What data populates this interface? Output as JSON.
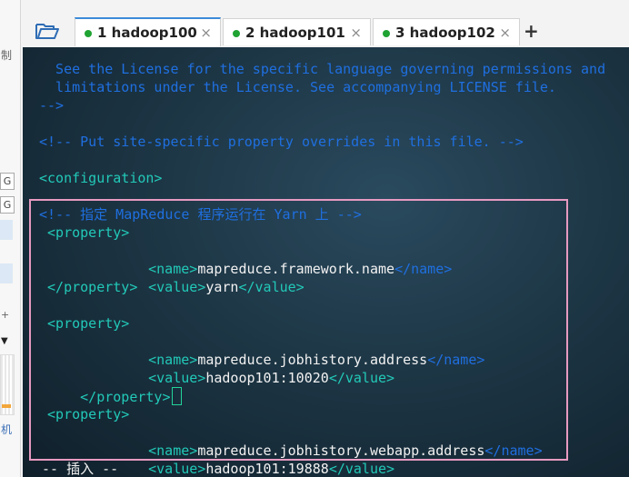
{
  "left_strip": {
    "top_char": "制",
    "box1": "G",
    "box2": "G",
    "plus": "+",
    "tri": "▼",
    "bottom_char": "机"
  },
  "tabs": [
    {
      "label": "1 hadoop100",
      "close": "×"
    },
    {
      "label": "2 hadoop101",
      "close": "×"
    },
    {
      "label": "3 hadoop102",
      "close": "×"
    }
  ],
  "new_tab": "+",
  "colors": {
    "comment": "#1f6fe0",
    "tag": "#22c9b8",
    "text": "#f2f2f2",
    "status_dot": "#1fa332",
    "highlight": "#e79ac1"
  },
  "editor": {
    "license_1": "  See the License for the specific language governing permissions and",
    "license_2": "  limitations under the License. See accompanying LICENSE file.",
    "comment_end": "-->",
    "put_site": "<!-- Put site-specific property overrides in this file. -->",
    "configuration": "<configuration>",
    "mr_comment": "<!-- 指定 MapReduce 程序运行在 Yarn 上 -->",
    "property_open": " <property>",
    "property_close": " </property>",
    "name_open": "<name>",
    "name_close": "</name>",
    "value_open": "<value>",
    "value_close": "</value>",
    "p1_name": "mapreduce.framework.name",
    "p1_value": "yarn",
    "p2_name": "mapreduce.jobhistory.address",
    "p2_value": "hadoop101:10020",
    "p3_name": "mapreduce.jobhistory.webapp.address",
    "p3_value": "hadoop101:19888",
    "mode": " -- 插入 --"
  }
}
